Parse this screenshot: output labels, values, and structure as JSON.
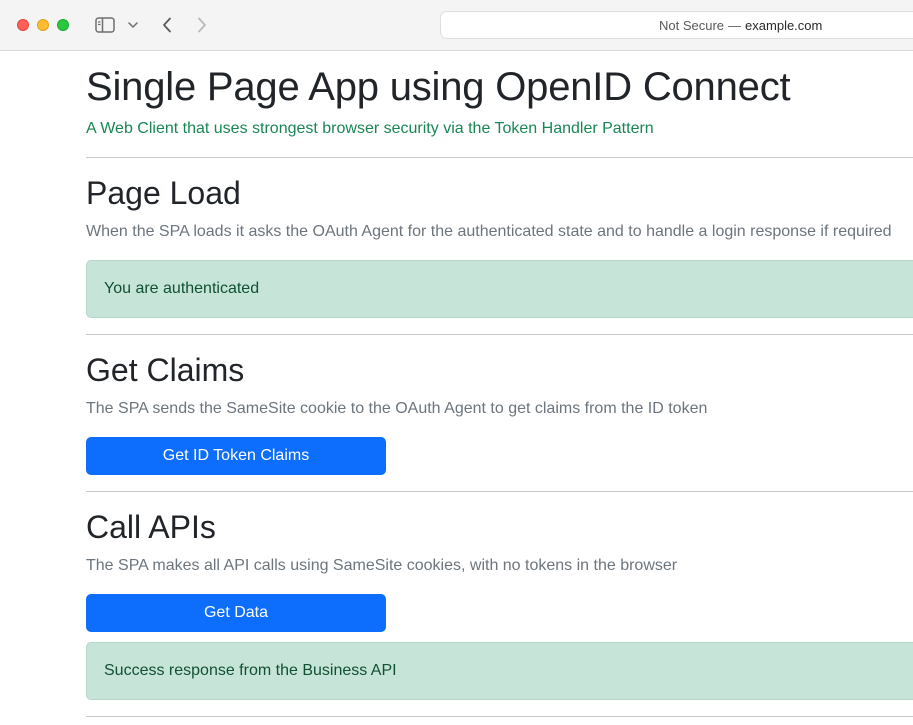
{
  "browser": {
    "url_status": "Not Secure",
    "url_separator": "—",
    "url_host": "example.com",
    "icons": [
      "sidebar-icon",
      "chevron-down-icon",
      "back-arrow-icon",
      "forward-arrow-icon"
    ]
  },
  "page": {
    "title": "Single Page App using OpenID Connect",
    "subtitle": "A Web Client that uses strongest browser security via the Token Handler Pattern"
  },
  "sections": {
    "page_load": {
      "heading": "Page Load",
      "description": "When the SPA loads it asks the OAuth Agent for the authenticated state and to handle a login response if required",
      "alert": "You are authenticated"
    },
    "get_claims": {
      "heading": "Get Claims",
      "description": "The SPA sends the SameSite cookie to the OAuth Agent to get claims from the ID token",
      "button": "Get ID Token Claims"
    },
    "call_apis": {
      "heading": "Call APIs",
      "description": "The SPA makes all API calls using SameSite cookies, with no tokens in the browser",
      "button": "Get Data",
      "alert": "Success response from the Business API"
    }
  },
  "colors": {
    "subtitle": "#198754",
    "primary_button": "#0d6efd",
    "success_alert_bg": "#c7e4d9",
    "success_alert_text": "#0f5132",
    "muted_text": "#6c757d"
  }
}
